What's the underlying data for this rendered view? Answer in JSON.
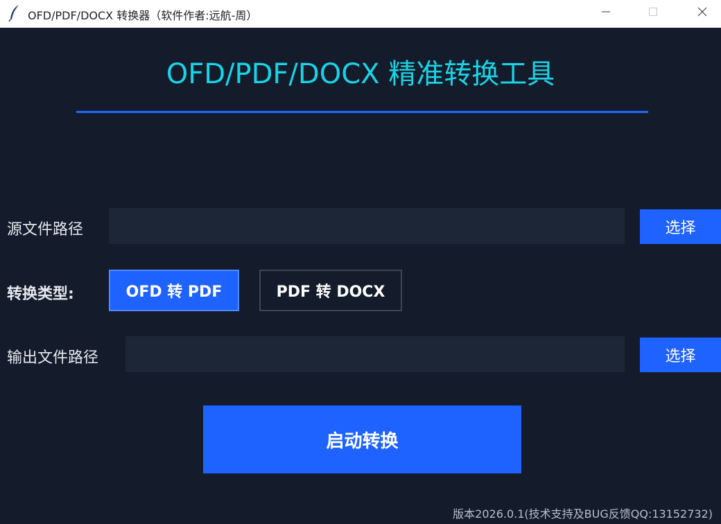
{
  "window": {
    "title": "OFD/PDF/DOCX 转换器（软件作者:远航-周）",
    "icon": "feather-icon",
    "controls": [
      "minimize-icon",
      "maximize-icon",
      "close-icon"
    ]
  },
  "header": {
    "title": "OFD/PDF/DOCX 精准转换工具"
  },
  "source": {
    "label": "源文件路径",
    "value": "",
    "choose_label": "选择"
  },
  "conversion": {
    "label": "转换类型:",
    "options": [
      "OFD 转 PDF",
      "PDF 转 DOCX"
    ],
    "selected": "OFD 转 PDF"
  },
  "output": {
    "label": "输出文件路径",
    "value": "",
    "choose_label": "选择"
  },
  "actions": {
    "start_label": "启动转换"
  },
  "footer": {
    "text": "版本2026.0.1(技术支持及BUG反馈QQ:13152732)"
  },
  "colors": {
    "background": "#141c2b",
    "title_cyan": "#19d3e6",
    "accent_blue": "#1e62ff",
    "divider_blue": "#1e6bff",
    "field_bg": "#1d2636"
  }
}
